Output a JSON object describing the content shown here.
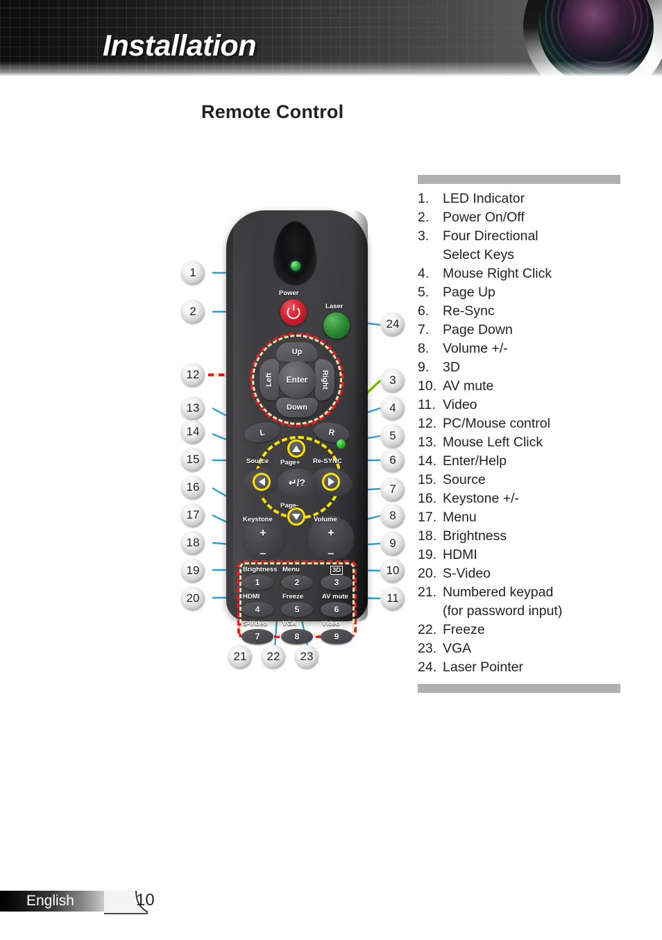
{
  "header": {
    "title": "Installation",
    "lens_icon": "camera-lens-icon"
  },
  "page_title": "Remote Control",
  "legend": {
    "items": [
      {
        "num": "1.",
        "text": "LED Indicator"
      },
      {
        "num": "2.",
        "text": "Power On/Off"
      },
      {
        "num": "3.",
        "text": "Four Directional",
        "cont": "Select Keys"
      },
      {
        "num": "4.",
        "text": "Mouse Right Click"
      },
      {
        "num": "5.",
        "text": "Page Up"
      },
      {
        "num": "6.",
        "text": "Re-Sync"
      },
      {
        "num": "7.",
        "text": "Page Down"
      },
      {
        "num": "8.",
        "text": "Volume +/-"
      },
      {
        "num": "9.",
        "text": "3D"
      },
      {
        "num": "10.",
        "text": "AV mute"
      },
      {
        "num": "11.",
        "text": "Video"
      },
      {
        "num": "12.",
        "text": "PC/Mouse control"
      },
      {
        "num": "13.",
        "text": "Mouse Left Click"
      },
      {
        "num": "14.",
        "text": "Enter/Help"
      },
      {
        "num": "15.",
        "text": "Source"
      },
      {
        "num": "16.",
        "text": "Keystone +/-"
      },
      {
        "num": "17.",
        "text": "Menu"
      },
      {
        "num": "18.",
        "text": "Brightness"
      },
      {
        "num": "19.",
        "text": "HDMI"
      },
      {
        "num": "20.",
        "text": "S-Video"
      },
      {
        "num": "21.",
        "text": "Numbered keypad",
        "cont": "(for password input)"
      },
      {
        "num": "22.",
        "text": "Freeze"
      },
      {
        "num": "23.",
        "text": "VGA"
      },
      {
        "num": "24.",
        "text": "Laser Pointer"
      }
    ]
  },
  "remote": {
    "labels": {
      "power": "Power",
      "laser": "Laser",
      "up": "Up",
      "down": "Down",
      "left": "Left",
      "right": "Right",
      "enter": "Enter",
      "mouse_left": "L",
      "mouse_right": "R",
      "page_up": "Page+",
      "page_down": "Page-",
      "source": "Source",
      "resync": "Re-SYNC",
      "enter_help": "↵/?",
      "keystone": "Keystone",
      "volume": "Volume",
      "keystone_plus": "+",
      "keystone_minus": "–",
      "volume_plus": "+",
      "volume_minus": "–"
    },
    "keypad": [
      {
        "label": "Brightness",
        "digit": "1",
        "boxed": false
      },
      {
        "label": "Menu",
        "digit": "2",
        "boxed": false
      },
      {
        "label": "3D",
        "digit": "3",
        "boxed": true
      },
      {
        "label": "HDMI",
        "digit": "4",
        "boxed": false
      },
      {
        "label": "Freeze",
        "digit": "5",
        "boxed": false
      },
      {
        "label": "AV mute",
        "digit": "6",
        "boxed": false
      },
      {
        "label": "S-Video",
        "digit": "7",
        "boxed": false
      },
      {
        "label": "VGA",
        "digit": "8",
        "boxed": false
      },
      {
        "label": "Video",
        "digit": "9",
        "boxed": false
      }
    ],
    "callouts_left": [
      "1",
      "2",
      "12",
      "13",
      "14",
      "15",
      "16",
      "17",
      "18",
      "19",
      "20"
    ],
    "callouts_right": [
      "24",
      "3",
      "4",
      "5",
      "6",
      "7",
      "8",
      "9",
      "10",
      "11"
    ],
    "callouts_bottom": [
      "21",
      "22",
      "23"
    ]
  },
  "colors": {
    "power_red": "#d5202f",
    "laser_green": "#2e8b34",
    "led_green": "#37b34a",
    "dashed_red": "#e31b23",
    "dashed_cream": "#f2e3b0",
    "dashed_yellow": "#ffe400",
    "callout_line_blue": "#2e9fd4",
    "legend_bar_gray": "#b0b0b0",
    "body_dark": "#3a3a3c"
  },
  "footer": {
    "language": "English",
    "page_number": "10"
  }
}
